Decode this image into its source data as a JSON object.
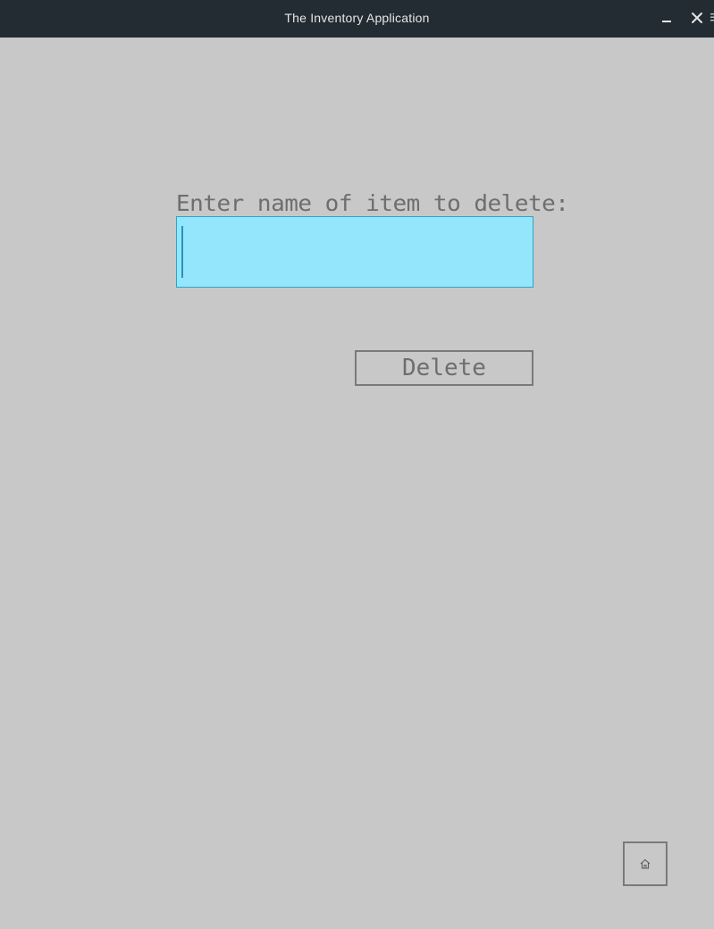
{
  "window": {
    "title": "The Inventory Application",
    "minimize_icon": "minimize-icon",
    "close_icon": "close-icon"
  },
  "form": {
    "prompt_label": "Enter name of item to delete:",
    "name_input": {
      "value": "",
      "placeholder": ""
    },
    "delete_label": "Delete"
  },
  "navigation": {
    "home_icon": "home-icon"
  },
  "colors": {
    "background": "#c8c8c8",
    "titlebar": "#232c33",
    "input_fill": "#94e6fd",
    "input_border": "#31a3c9",
    "text_gray": "#6e6e6e",
    "button_border": "#7a7a7a"
  }
}
